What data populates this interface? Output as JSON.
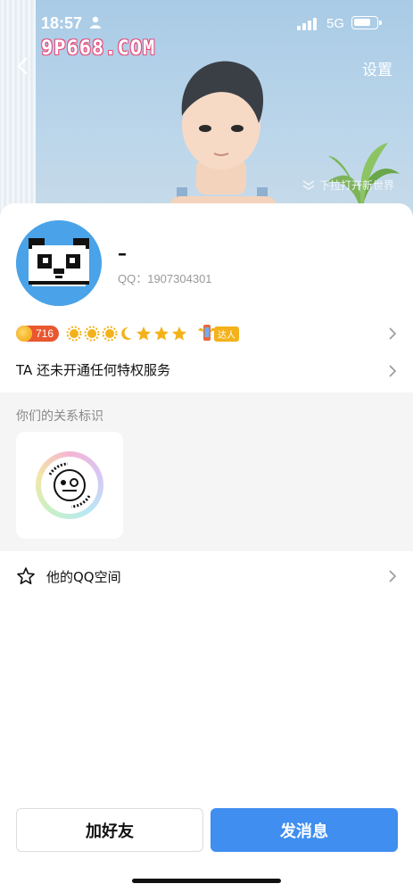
{
  "status_bar": {
    "time": "18:57",
    "network": "5G"
  },
  "watermark": "9P668.COM",
  "header": {
    "settings_label": "设置",
    "pull_hint": "下拉打开新世界"
  },
  "profile": {
    "nickname": "–",
    "qq_label": "QQ：1907304301",
    "coin_value": "716",
    "daren_label": "达人"
  },
  "privilege": {
    "label": "TA 还未开通任何特权服务"
  },
  "relation": {
    "title": "你们的关系标识"
  },
  "qzone": {
    "label": "他的QQ空间"
  },
  "actions": {
    "add_friend": "加好友",
    "send_message": "发消息"
  },
  "colors": {
    "primary_button": "#3f8ef0",
    "coin_badge": "#e9572f",
    "section_bg": "#f5f5f5"
  }
}
